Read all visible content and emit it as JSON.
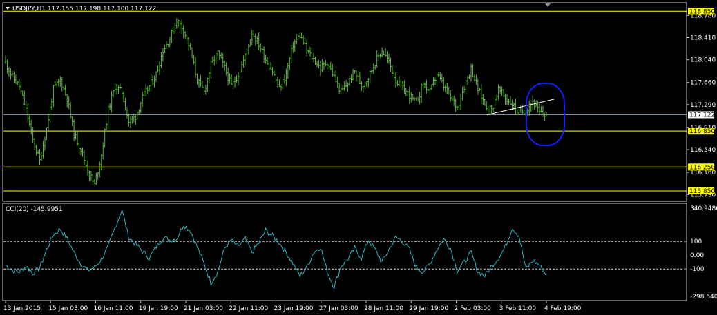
{
  "header": {
    "symbol_line": "USDJPY,H1  117.155 117.198 117.100 117.122",
    "dropdown_icon": "triangle-down-icon"
  },
  "indicator": {
    "label": "CCI(20) -145.9951"
  },
  "colors": {
    "background": "#000000",
    "price_bars": "#5fb83a",
    "cci_line": "#2fb7c4",
    "level_lines": "#ffff00",
    "current_price_line": "#8090a8",
    "trend_line": "#ffffff",
    "highlight_ellipse": "#1020ff",
    "axis_text": "#ffffff"
  },
  "price_axis_labels": [
    "118.780",
    "118.410",
    "118.040",
    "117.660",
    "117.290",
    "116.910",
    "116.540",
    "116.160",
    "115.790"
  ],
  "level_tags": [
    "118.850",
    "116.850",
    "116.250",
    "115.850"
  ],
  "current_price_tag": "117.122",
  "cci_axis_labels": [
    "340.9486",
    "100",
    "0.00",
    "-100",
    "-298.6405"
  ],
  "time_labels": [
    "13 Jan 2015",
    "15 Jan 03:00",
    "16 Jan 11:00",
    "19 Jan 19:00",
    "21 Jan 03:00",
    "22 Jan 11:00",
    "23 Jan 19:00",
    "27 Jan 03:00",
    "28 Jan 11:00",
    "29 Jan 19:00",
    "2 Feb 03:00",
    "3 Feb 11:00",
    "4 Feb 19:00"
  ],
  "chart_data": [
    {
      "type": "bar",
      "title": "USDJPY,H1",
      "ylim": [
        115.77,
        118.83
      ],
      "horizontal_levels": [
        118.85,
        116.85,
        116.25,
        115.85
      ],
      "current_price": 117.122,
      "trend_line": {
        "from_close": 117.12,
        "to_close": 117.38
      },
      "x": [
        "13 Jan 2015",
        "15 Jan 03:00",
        "16 Jan 11:00",
        "19 Jan 19:00",
        "21 Jan 03:00",
        "22 Jan 11:00",
        "23 Jan 19:00",
        "27 Jan 03:00",
        "28 Jan 11:00",
        "29 Jan 19:00",
        "2 Feb 03:00",
        "3 Feb 11:00",
        "4 Feb 19:00"
      ],
      "series": [
        {
          "values": [
            118.0,
            117.75,
            117.6,
            117.2,
            116.7,
            116.35,
            116.9,
            117.55,
            117.7,
            117.4,
            116.8,
            116.55,
            116.2,
            115.95,
            116.45,
            117.2,
            117.6,
            117.5,
            117.0,
            117.1,
            117.4,
            117.6,
            117.8,
            118.2,
            118.4,
            118.7,
            118.55,
            118.2,
            117.7,
            117.5,
            117.95,
            118.15,
            117.9,
            117.6,
            117.8,
            118.1,
            118.5,
            118.3,
            118.05,
            117.85,
            117.55,
            117.8,
            118.3,
            118.45,
            118.2,
            118.05,
            117.9,
            118.0,
            117.75,
            117.5,
            117.65,
            117.85,
            117.6,
            117.75,
            118.0,
            118.2,
            118.0,
            117.7,
            117.55,
            117.45,
            117.3,
            117.65,
            117.5,
            117.8,
            117.6,
            117.4,
            117.25,
            117.6,
            117.9,
            117.55,
            117.3,
            117.2,
            117.55,
            117.4,
            117.3,
            117.15,
            117.2,
            117.35,
            117.15,
            117.12
          ]
        }
      ]
    },
    {
      "type": "line",
      "title": "CCI(20)",
      "ylim": [
        -298.6405,
        340.9486
      ],
      "levels": [
        100,
        -100
      ],
      "last_value": -145.9951,
      "x": [
        "13 Jan 2015",
        "15 Jan 03:00",
        "16 Jan 11:00",
        "19 Jan 19:00",
        "21 Jan 03:00",
        "22 Jan 11:00",
        "23 Jan 19:00",
        "27 Jan 03:00",
        "28 Jan 11:00",
        "29 Jan 19:00",
        "2 Feb 03:00",
        "3 Feb 11:00",
        "4 Feb 19:00"
      ],
      "series": [
        {
          "values": [
            -70,
            -110,
            -120,
            -80,
            -130,
            -90,
            40,
            150,
            190,
            120,
            20,
            -60,
            -110,
            -90,
            -30,
            60,
            200,
            330,
            130,
            80,
            30,
            -20,
            60,
            130,
            110,
            120,
            220,
            180,
            60,
            -60,
            -200,
            -120,
            50,
            110,
            60,
            120,
            20,
            90,
            180,
            140,
            90,
            20,
            -60,
            -150,
            -90,
            20,
            60,
            -120,
            -230,
            -80,
            -30,
            50,
            -20,
            110,
            40,
            -50,
            40,
            130,
            100,
            40,
            -90,
            -120,
            -60,
            40,
            120,
            50,
            -110,
            -50,
            20,
            -120,
            -150,
            -80,
            -20,
            60,
            200,
            140,
            -100,
            -40,
            -70,
            -146
          ]
        }
      ]
    }
  ]
}
